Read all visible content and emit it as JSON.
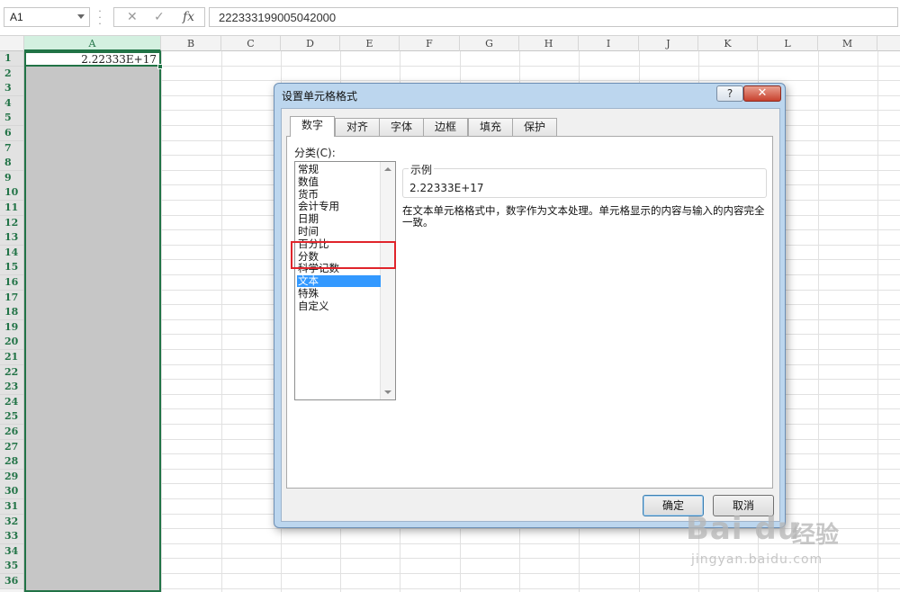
{
  "formula_bar": {
    "name_box": "A1",
    "fx_label": "fx",
    "cancel_glyph": "✕",
    "enter_glyph": "✓",
    "formula_value": "222333199005042000"
  },
  "sheet": {
    "columns": [
      "A",
      "B",
      "C",
      "D",
      "E",
      "F",
      "G",
      "H",
      "I",
      "J",
      "K",
      "L",
      "M"
    ],
    "rows": [
      "1",
      "2",
      "3",
      "4",
      "5",
      "6",
      "7",
      "8",
      "9",
      "10",
      "11",
      "12",
      "13",
      "14",
      "15",
      "16",
      "17",
      "18",
      "19",
      "20",
      "21",
      "22",
      "23",
      "24",
      "25",
      "26",
      "27",
      "28",
      "29",
      "30",
      "31",
      "32",
      "33",
      "34",
      "35",
      "36"
    ],
    "selected_column": "A",
    "cell_a1_value": "2.22333E+17"
  },
  "dialog": {
    "title": "设置单元格格式",
    "help_label": "?",
    "close_label": "✕",
    "tabs": [
      "数字",
      "对齐",
      "字体",
      "边框",
      "填充",
      "保护"
    ],
    "active_tab": "数字",
    "category_label": "分类(C):",
    "categories": [
      "常规",
      "数值",
      "货币",
      "会计专用",
      "日期",
      "时间",
      "百分比",
      "分数",
      "科学记数",
      "文本",
      "特殊",
      "自定义"
    ],
    "selected_category": "文本",
    "sample_label": "示例",
    "sample_value": "2.22333E+17",
    "description": "在文本单元格格式中，数字作为文本处理。单元格显示的内容与输入的内容完全一致。",
    "ok_label": "确定",
    "cancel_label": "取消"
  },
  "watermark": {
    "brand": "Bai  du",
    "brand_cn": "经验",
    "url": "jingyan.baidu.com"
  },
  "colors": {
    "excel_green": "#217346",
    "selected_item": "#3399ff",
    "highlight_red": "#e0242b",
    "dialog_frame": "#bcd6ee"
  }
}
